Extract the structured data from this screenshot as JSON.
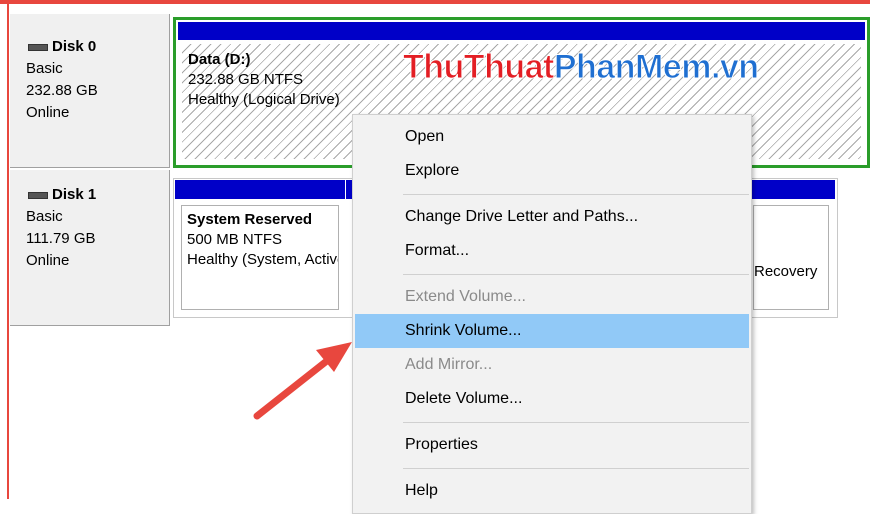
{
  "disks": [
    {
      "name": "Disk 0",
      "type": "Basic",
      "size": "232.88 GB",
      "status": "Online"
    },
    {
      "name": "Disk 1",
      "type": "Basic",
      "size": "111.79 GB",
      "status": "Online"
    }
  ],
  "partitions": {
    "data_d": {
      "title": "Data  (D:)",
      "size": "232.88 GB NTFS",
      "status": "Healthy (Logical Drive)"
    },
    "system_reserved": {
      "title": "System Reserved",
      "size": "500 MB NTFS",
      "status": "Healthy (System, Active, Primary Partition)"
    },
    "recovery": {
      "status": "Recovery"
    }
  },
  "watermark": {
    "part1": "ThuThuat",
    "part2": "PhanMem",
    "part3": ".vn"
  },
  "menu": {
    "items": [
      {
        "label": "Open",
        "enabled": true
      },
      {
        "label": "Explore",
        "enabled": true
      },
      {
        "label": "Change Drive Letter and Paths...",
        "enabled": true
      },
      {
        "label": "Format...",
        "enabled": true
      },
      {
        "label": "Extend Volume...",
        "enabled": false
      },
      {
        "label": "Shrink Volume...",
        "enabled": true,
        "highlighted": true
      },
      {
        "label": "Add Mirror...",
        "enabled": false
      },
      {
        "label": "Delete Volume...",
        "enabled": true
      },
      {
        "label": "Properties",
        "enabled": true
      },
      {
        "label": "Help",
        "enabled": true
      }
    ]
  },
  "colors": {
    "partition_bar": "#0000c8",
    "selection_border": "#2a9d2a",
    "menu_highlight": "#91c9f7",
    "annotation_arrow": "#e8473e",
    "watermark_red": "#e31e24",
    "watermark_blue": "#1f6fd1"
  }
}
